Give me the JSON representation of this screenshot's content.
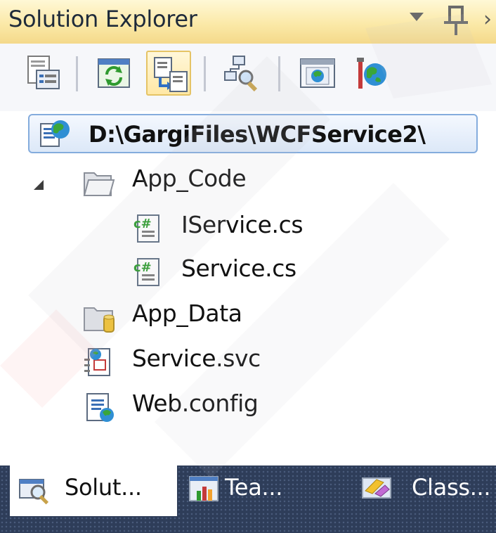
{
  "panel": {
    "title": "Solution Explorer"
  },
  "toolbar": {
    "buttons": [
      {
        "name": "properties-button",
        "icon": "properties-icon",
        "active": false
      },
      {
        "name": "refresh-button",
        "icon": "refresh-icon",
        "active": false
      },
      {
        "name": "nest-related-files-button",
        "icon": "nest-related-files-icon",
        "active": true
      },
      {
        "name": "view-class-diagram-button",
        "icon": "class-diagram-icon",
        "active": false
      },
      {
        "name": "view-in-browser-button",
        "icon": "browser-icon",
        "active": false
      },
      {
        "name": "asp-net-configuration-button",
        "icon": "website-config-icon",
        "active": false
      }
    ]
  },
  "tree": {
    "root": {
      "label": "D:\\GargiFiles\\WCFService2\\",
      "icon": "website-project-icon"
    },
    "items": [
      {
        "label": "App_Code",
        "icon": "folder-open-icon",
        "depth": 1,
        "expanded": true
      },
      {
        "label": "IService.cs",
        "icon": "csharp-file-icon",
        "depth": 2
      },
      {
        "label": "Service.cs",
        "icon": "csharp-file-icon",
        "depth": 2
      },
      {
        "label": "App_Data",
        "icon": "database-folder-icon",
        "depth": 1
      },
      {
        "label": "Service.svc",
        "icon": "svc-file-icon",
        "depth": 1
      },
      {
        "label": "Web.config",
        "icon": "config-file-icon",
        "depth": 1
      }
    ]
  },
  "tabs": [
    {
      "label": "Solut...",
      "icon": "solution-explorer-icon",
      "active": true
    },
    {
      "label": "Tea...",
      "icon": "team-explorer-icon",
      "active": false
    },
    {
      "label": "Class...",
      "icon": "class-view-icon",
      "active": false
    }
  ],
  "colors": {
    "title_bar": "#fbe9a8",
    "tab_bar": "#2e3d59",
    "selection_border": "#84acdd"
  }
}
